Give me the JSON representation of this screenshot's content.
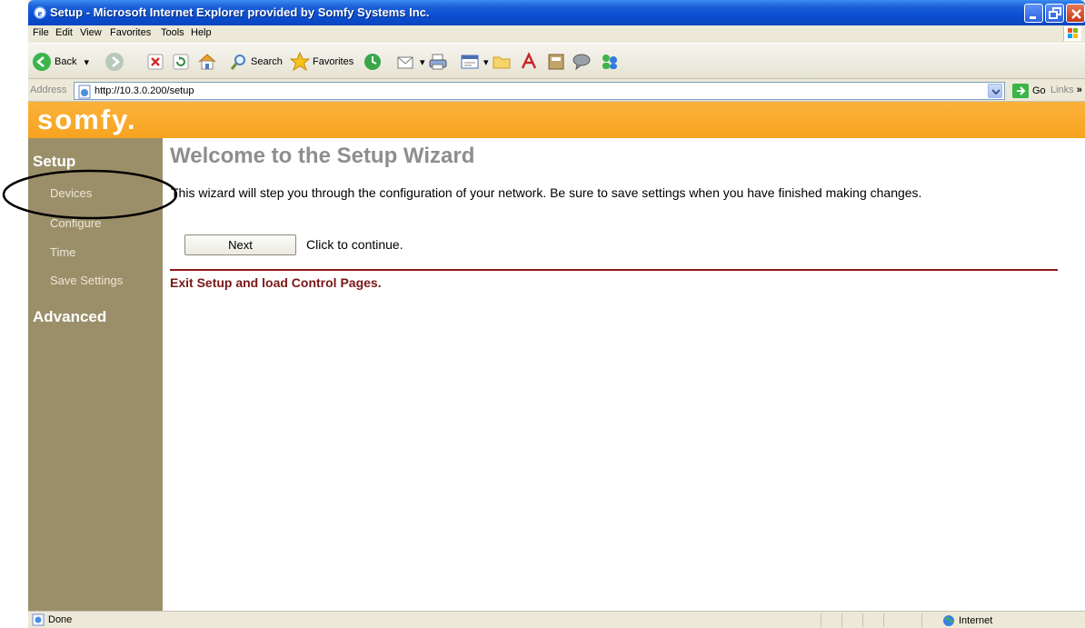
{
  "window": {
    "title": "Setup - Microsoft Internet Explorer provided by Somfy Systems Inc."
  },
  "menu": [
    "File",
    "Edit",
    "View",
    "Favorites",
    "Tools",
    "Help"
  ],
  "toolbar": {
    "back_label": "Back",
    "search_label": "Search",
    "favorites_label": "Favorites"
  },
  "address": {
    "label": "Address",
    "url": "http://10.3.0.200/setup",
    "go_label": "Go",
    "links_label": "Links"
  },
  "brand": {
    "logo": "somfy.",
    "accent_color": "#f7a320",
    "sidebar_color": "#9b8f6a"
  },
  "sidebar": {
    "setup_heading": "Setup",
    "items": [
      {
        "label": "Devices"
      },
      {
        "label": "Configure"
      },
      {
        "label": "Time"
      },
      {
        "label": "Save Settings"
      }
    ],
    "advanced_heading": "Advanced"
  },
  "content": {
    "heading": "Welcome to the Setup Wizard",
    "description": "This wizard will step you through the configuration of your network. Be sure to save settings when you have finished making changes.",
    "next_button": "Next",
    "next_hint": "Click to continue.",
    "exit_link": "Exit Setup and load Control Pages."
  },
  "status": {
    "text": "Done",
    "zone": "Internet"
  }
}
